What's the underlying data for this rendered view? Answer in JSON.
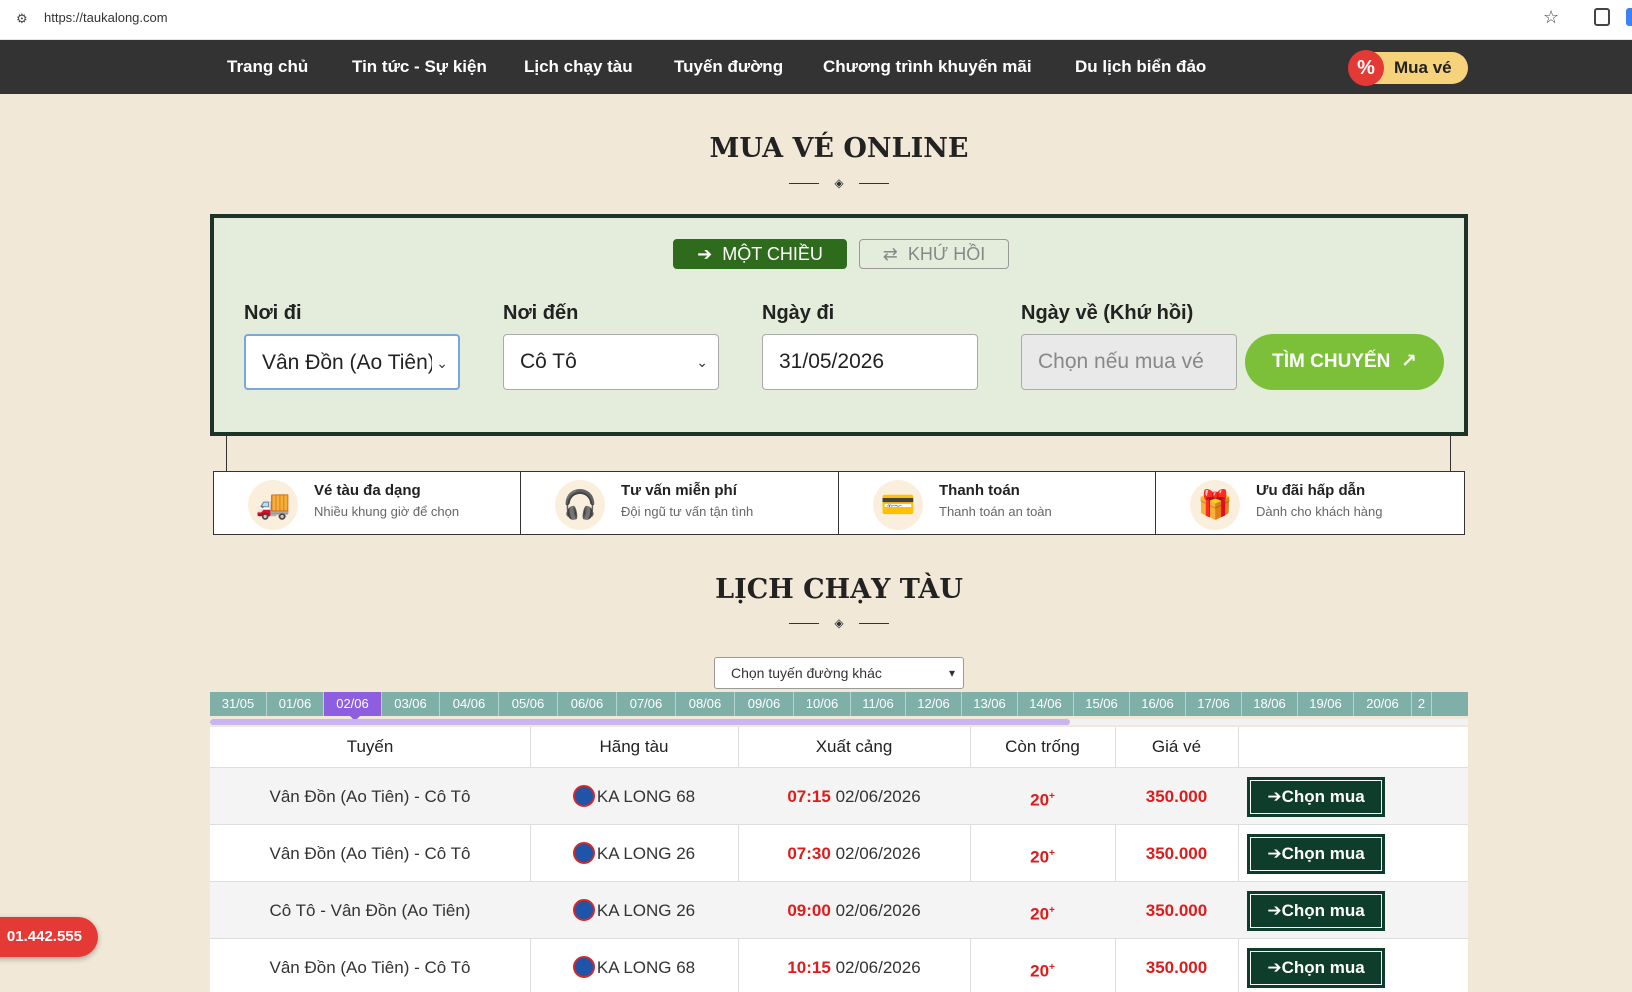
{
  "browser": {
    "url": "https://taukalong.com"
  },
  "nav": {
    "items": [
      "Trang chủ",
      "Tin tức - Sự kiện",
      "Lịch chạy tàu",
      "Tuyến đường",
      "Chương trình khuyến mãi",
      "Du lịch biển đảo"
    ],
    "buy_badge": "%",
    "buy_label": "Mua vé"
  },
  "booking": {
    "title": "MUA VÉ ONLINE",
    "trip_one_way": "MỘT CHIỀU",
    "trip_round": "KHỨ HỒI",
    "from_label": "Nơi đi",
    "from_value": "Vân Đồn (Ao Tiên)",
    "to_label": "Nơi đến",
    "to_value": "Cô Tô",
    "date_label": "Ngày đi",
    "date_value": "31/05/2026",
    "return_label": "Ngày về (Khứ hồi)",
    "return_placeholder": "Chọn nếu mua vé",
    "search_label": "TÌM CHUYẾN"
  },
  "features": [
    {
      "title": "Vé tàu đa dạng",
      "sub": "Nhiều khung giờ để chọn"
    },
    {
      "title": "Tư vấn miễn phí",
      "sub": "Đội ngũ tư vấn tận tình"
    },
    {
      "title": "Thanh toán",
      "sub": "Thanh toán an toàn"
    },
    {
      "title": "Ưu đãi hấp dẫn",
      "sub": "Dành cho khách hàng"
    }
  ],
  "schedule": {
    "title": "LỊCH CHẠY TÀU",
    "route_select": "Chọn tuyến đường khác",
    "dates": [
      "31/05",
      "01/06",
      "02/06",
      "03/06",
      "04/06",
      "05/06",
      "06/06",
      "07/06",
      "08/06",
      "09/06",
      "10/06",
      "11/06",
      "12/06",
      "13/06",
      "14/06",
      "15/06",
      "16/06",
      "17/06",
      "18/06",
      "19/06",
      "20/06",
      "2"
    ],
    "active_date": "02/06",
    "headers": [
      "Tuyến",
      "Hãng tàu",
      "Xuất cảng",
      "Còn trống",
      "Giá vé",
      ""
    ],
    "rows": [
      {
        "route": "Vân Đồn (Ao Tiên) - Cô Tô",
        "boat": "KA LONG 68",
        "time": "07:15",
        "date": "02/06/2026",
        "seats": "20",
        "price": "350.000",
        "action": "Chọn mua"
      },
      {
        "route": "Vân Đồn (Ao Tiên) - Cô Tô",
        "boat": "KA LONG 26",
        "time": "07:30",
        "date": "02/06/2026",
        "seats": "20",
        "price": "350.000",
        "action": "Chọn mua"
      },
      {
        "route": "Cô Tô - Vân Đồn (Ao Tiên)",
        "boat": "KA LONG 26",
        "time": "09:00",
        "date": "02/06/2026",
        "seats": "20",
        "price": "350.000",
        "action": "Chọn mua"
      },
      {
        "route": "Vân Đồn (Ao Tiên) - Cô Tô",
        "boat": "KA LONG 68",
        "time": "10:15",
        "date": "02/06/2026",
        "seats": "20",
        "price": "350.000",
        "action": "Chọn mua"
      }
    ]
  },
  "hotline": "01.442.555"
}
